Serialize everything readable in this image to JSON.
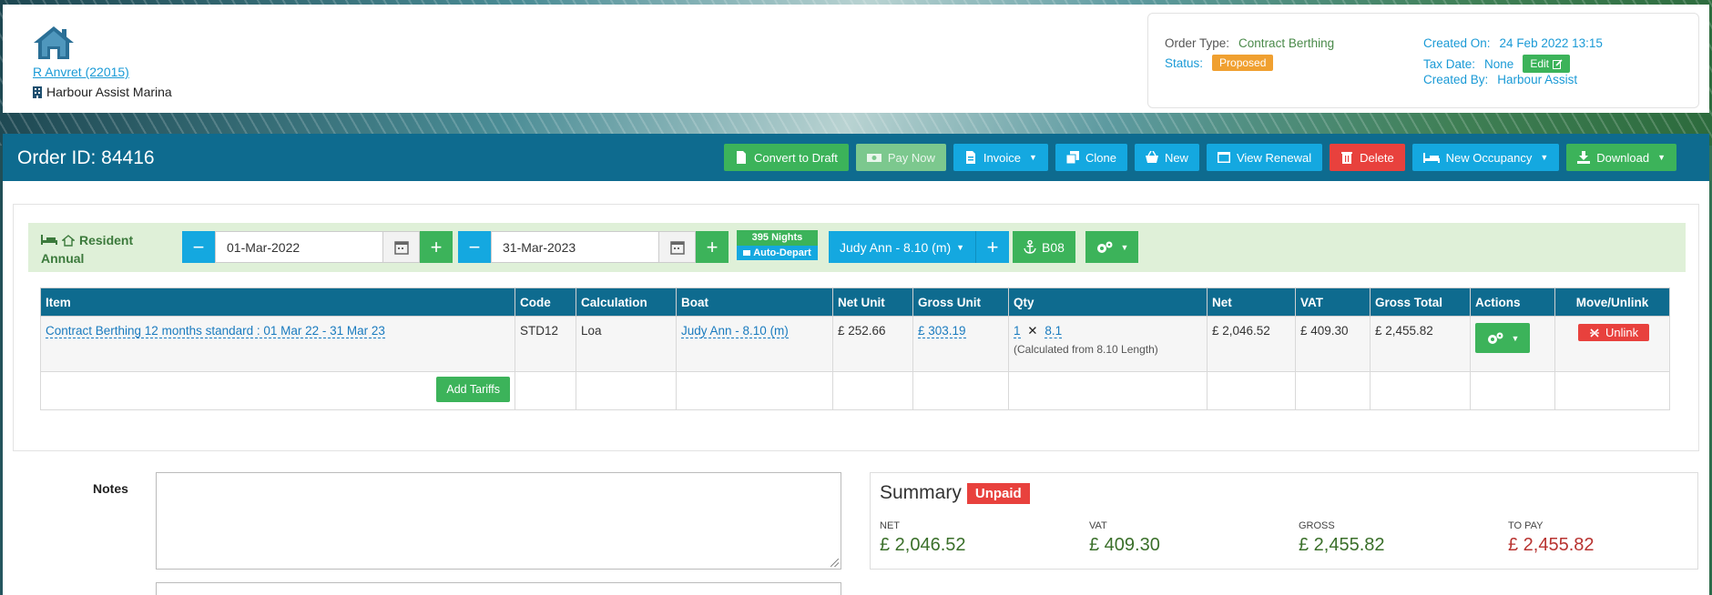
{
  "header": {
    "customer_link": "R Anvret (22015)",
    "marina_name": "Harbour Assist Marina",
    "order_type_label": "Order Type:",
    "order_type_value": "Contract Berthing",
    "status_label": "Status:",
    "status_value": "Proposed",
    "created_on_label": "Created On:",
    "created_on_value": "24 Feb 2022 13:15",
    "tax_date_label": "Tax Date:",
    "tax_date_value": "None",
    "edit_label": "Edit",
    "created_by_label": "Created By:",
    "created_by_value": "Harbour Assist"
  },
  "order_bar": {
    "title": "Order ID: 84416",
    "buttons": {
      "convert_to_draft": "Convert to Draft",
      "pay_now": "Pay Now",
      "invoice": "Invoice",
      "clone": "Clone",
      "new": "New",
      "view_renewal": "View Renewal",
      "delete": "Delete",
      "new_occupancy": "New Occupancy",
      "download": "Download"
    }
  },
  "occupancy": {
    "resident_label_1": "Resident",
    "resident_label_2": "Annual",
    "start_date": "01-Mar-2022",
    "end_date": "31-Mar-2023",
    "nights": "395 Nights",
    "auto_depart": "Auto-Depart",
    "boat": "Judy Ann - 8.10 (m)",
    "berth": "B08"
  },
  "table": {
    "headers": [
      "Item",
      "Code",
      "Calculation",
      "Boat",
      "Net Unit",
      "Gross Unit",
      "Qty",
      "Net",
      "VAT",
      "Gross Total",
      "Actions",
      "Move/Unlink"
    ],
    "row": {
      "item": "Contract Berthing 12 months standard : 01 Mar 22 - 31 Mar 23",
      "code": "STD12",
      "calculation": "Loa",
      "boat": "Judy Ann - 8.10 (m)",
      "net_unit": "£ 252.66",
      "gross_unit": "£ 303.19",
      "qty_a": "1",
      "qty_x": "✕",
      "qty_b": "8.1",
      "qty_note": "(Calculated from 8.10 Length)",
      "net": "£ 2,046.52",
      "vat": "£ 409.30",
      "gross_total": "£ 2,455.82",
      "unlink": "Unlink"
    },
    "add_tariffs": "Add Tariffs"
  },
  "notes": {
    "label": "Notes"
  },
  "summary": {
    "title": "Summary",
    "badge": "Unpaid",
    "net_label": "NET",
    "net_value": "£ 2,046.52",
    "vat_label": "VAT",
    "vat_value": "£ 409.30",
    "gross_label": "GROSS",
    "gross_value": "£ 2,455.82",
    "topay_label": "TO PAY",
    "topay_value": "£ 2,455.82"
  },
  "colors": {
    "primary_bar": "#0e6b8f",
    "green": "#3cb35a",
    "blue": "#14a8e0",
    "red": "#e8413d",
    "orange": "#f0a030"
  }
}
